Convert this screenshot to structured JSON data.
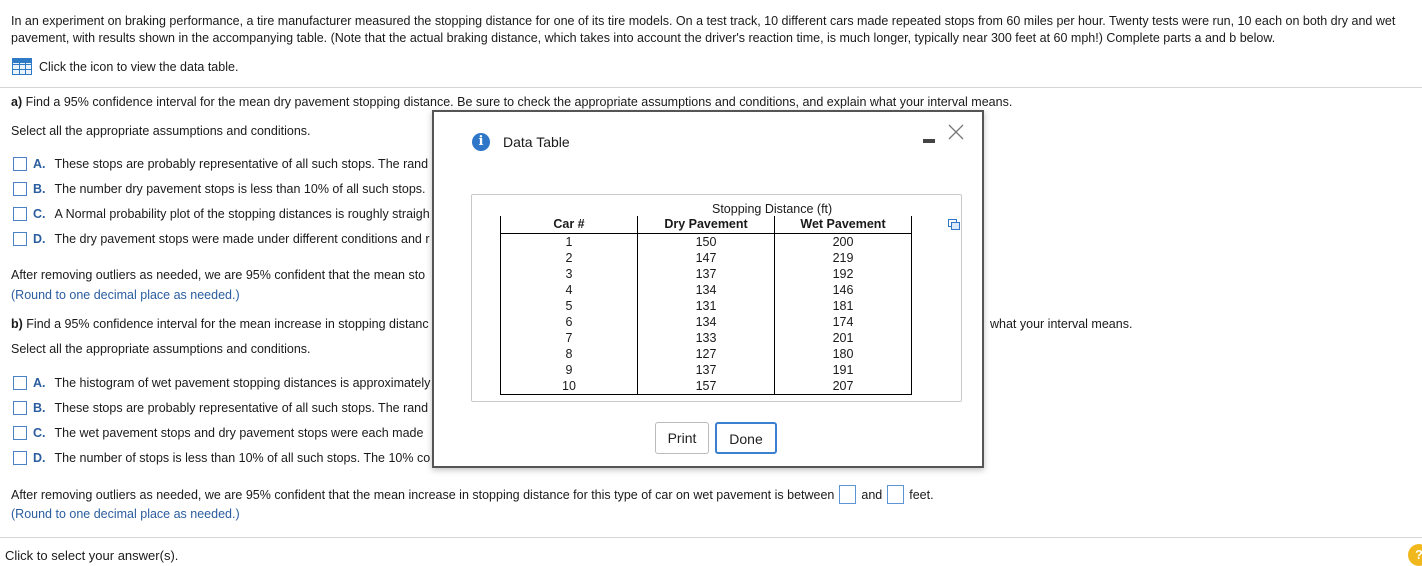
{
  "intro": "In an experiment on braking performance, a tire manufacturer measured the stopping distance for one of its tire models. On a test track, 10 different cars made repeated stops from 60 miles per hour. Twenty tests were run, 10 each on both dry and wet pavement, with results shown in the accompanying table. (Note that the actual braking distance, which takes into account the driver's reaction time, is much longer, typically near 300 feet at 60 mph!) Complete parts a and b below.",
  "data_table_link": "Click the icon to view the data table.",
  "part_a": {
    "label": "a)",
    "question": "Find a 95% confidence interval for the mean dry pavement stopping distance. Be sure to check the appropriate assumptions and conditions, and explain what your interval means.",
    "select_prompt": "Select all the appropriate assumptions and conditions.",
    "options": [
      {
        "letter": "A.",
        "text": "These stops are probably representative of all such stops. The rand"
      },
      {
        "letter": "B.",
        "text": "The number dry pavement stops is less than 10% of all such stops."
      },
      {
        "letter": "C.",
        "text": "A Normal probability plot of the stopping distances is roughly straigh"
      },
      {
        "letter": "D.",
        "text": "The dry pavement stops were made under different conditions and r"
      }
    ],
    "conclusion": "After removing outliers as needed, we are 95% confident that the mean sto",
    "round_note": "(Round to one decimal place as needed.)"
  },
  "part_b": {
    "label": "b)",
    "question": "Find a 95% confidence interval for the mean increase in stopping distanc",
    "question_tail": "what your interval means.",
    "select_prompt": "Select all the appropriate assumptions and conditions.",
    "options": [
      {
        "letter": "A.",
        "text": "The histogram of wet pavement stopping distances is approximately"
      },
      {
        "letter": "B.",
        "text": "These stops are probably representative of all such stops. The rand"
      },
      {
        "letter": "C.",
        "text": "The wet pavement stops and dry pavement stops were each made"
      },
      {
        "letter": "D.",
        "text": "The number of stops is less than 10% of all such stops. The 10% co"
      }
    ],
    "conclusion_pre": "After removing outliers as needed, we are 95% confident that the mean increase in stopping distance for this type of car on wet pavement is between",
    "conclusion_and": "and",
    "conclusion_post": "feet.",
    "round_note": "(Round to one decimal place as needed.)"
  },
  "footer": "Click to select your answer(s).",
  "help_glyph": "?",
  "modal": {
    "title": "Data Table",
    "info_glyph": "i",
    "table_title": "Stopping Distance (ft)",
    "columns": [
      "Car #",
      "Dry Pavement",
      "Wet Pavement"
    ],
    "rows": [
      [
        "1",
        "150",
        "200"
      ],
      [
        "2",
        "147",
        "219"
      ],
      [
        "3",
        "137",
        "192"
      ],
      [
        "4",
        "134",
        "146"
      ],
      [
        "5",
        "131",
        "181"
      ],
      [
        "6",
        "134",
        "174"
      ],
      [
        "7",
        "133",
        "201"
      ],
      [
        "8",
        "127",
        "180"
      ],
      [
        "9",
        "137",
        "191"
      ],
      [
        "10",
        "157",
        "207"
      ]
    ],
    "print_label": "Print",
    "done_label": "Done"
  },
  "colors": {
    "accent": "#2f76c8",
    "link_text": "#2a5d9f",
    "help": "#f0b81c"
  }
}
